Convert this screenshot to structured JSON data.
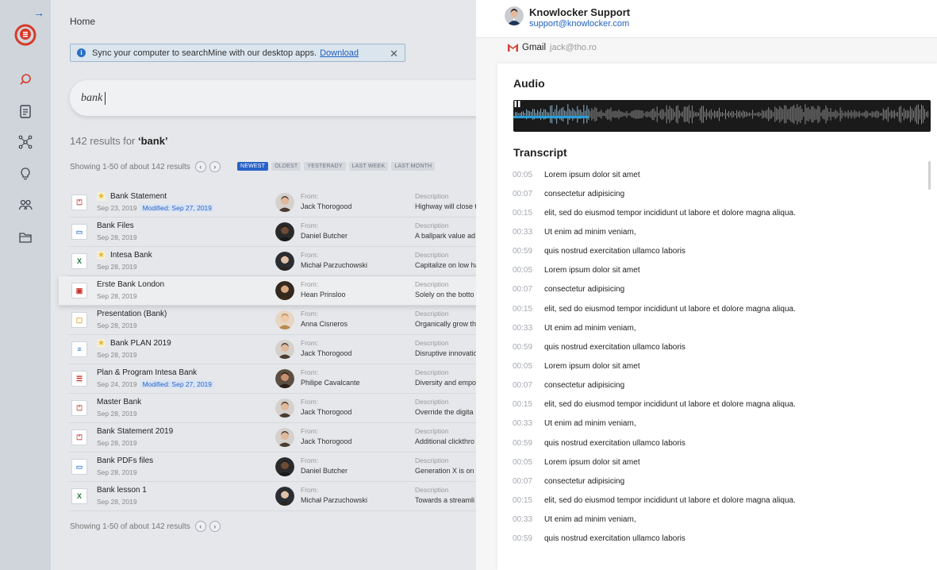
{
  "breadcrumb": "Home",
  "sync": {
    "text": "Sync your computer to searchMine with our desktop apps.",
    "link": "Download"
  },
  "search": {
    "query": "bank"
  },
  "results": {
    "count_prefix": "142 results for ",
    "count_query": "‘bank’",
    "showing": "Showing 1-50 of about 142 results",
    "filters": [
      "NEWEST",
      "OLDEST",
      "YESTERADY",
      "LAST WEEK",
      "LAST MONTH"
    ],
    "from_label": "From:",
    "desc_label": "Description",
    "rows": [
      {
        "name": "Bank Statement",
        "date": "Sep 23, 2019",
        "modified": "Modified: Sep 27, 2019",
        "from": "Jack Thorogood",
        "desc": "Highway will close t",
        "type": "pdf",
        "starred": true
      },
      {
        "name": "Bank Files",
        "date": "Sep 28, 2019",
        "modified": "",
        "from": "Daniel Butcher",
        "desc": "A ballpark value ad",
        "type": "folder",
        "starred": false
      },
      {
        "name": "Intesa Bank",
        "date": "Sep 28, 2019",
        "modified": "",
        "from": "Michał Parzuchowski",
        "desc": "Capitalize on low ha",
        "type": "excel",
        "starred": true
      },
      {
        "name": "Erste Bank London",
        "date": "Sep 28, 2019",
        "modified": "",
        "from": "Hean Prinsloo",
        "desc": "Solely on the botto",
        "type": "image",
        "starred": false
      },
      {
        "name": "Presentation (Bank)",
        "date": "Sep 28, 2019",
        "modified": "",
        "from": "Anna Cisneros",
        "desc": "Organically grow th",
        "type": "slides",
        "starred": false
      },
      {
        "name": "Bank PLAN 2019",
        "date": "Sep 28, 2019",
        "modified": "",
        "from": "Jack Thorogood",
        "desc": "Disruptive innovatio",
        "type": "doc",
        "starred": true
      },
      {
        "name": "Plan & Program Intesa Bank",
        "date": "Sep 24, 2019",
        "modified": "Modified: Sep 27, 2019",
        "from": "Philipe Cavalcante",
        "desc": "Diversity and empo",
        "type": "text",
        "starred": false
      },
      {
        "name": "Master Bank",
        "date": "Sep 28, 2019",
        "modified": "",
        "from": "Jack Thorogood",
        "desc": "Override the digita",
        "type": "pdf",
        "starred": false
      },
      {
        "name": "Bank Statement 2019",
        "date": "Sep 28, 2019",
        "modified": "",
        "from": "Jack Thorogood",
        "desc": "Additional clickthro",
        "type": "pdf",
        "starred": false
      },
      {
        "name": "Bank PDFs files",
        "date": "Sep 28, 2019",
        "modified": "",
        "from": "Daniel Butcher",
        "desc": "Generation X is on t",
        "type": "folder",
        "starred": false
      },
      {
        "name": "Bank lesson 1",
        "date": "Sep 28, 2019",
        "modified": "",
        "from": "Michał Parzuchowski",
        "desc": "Towards a streamli",
        "type": "excel",
        "starred": false
      }
    ]
  },
  "panel": {
    "support_name": "Knowlocker Support",
    "support_email": "support@knowlocker.com",
    "source": "Gmail",
    "source_address": "jack@tho.ro",
    "audio_title": "Audio",
    "audio_progress": 0.18,
    "transcript_title": "Transcript",
    "transcript": [
      {
        "time": "00:05",
        "text": "Lorem ipsum dolor sit amet"
      },
      {
        "time": "00:07",
        "text": "consectetur adipisicing"
      },
      {
        "time": "00:15",
        "text": "elit, sed do eiusmod tempor incididunt ut labore et dolore magna aliqua."
      },
      {
        "time": "00:33",
        "text": "Ut enim ad minim veniam,"
      },
      {
        "time": "00:59",
        "text": "quis nostrud exercitation ullamco laboris"
      },
      {
        "time": "00:05",
        "text": "Lorem ipsum dolor sit amet"
      },
      {
        "time": "00:07",
        "text": "consectetur adipisicing"
      },
      {
        "time": "00:15",
        "text": "elit, sed do eiusmod tempor incididunt ut labore et dolore magna aliqua."
      },
      {
        "time": "00:33",
        "text": "Ut enim ad minim veniam,"
      },
      {
        "time": "00:59",
        "text": "quis nostrud exercitation ullamco laboris"
      },
      {
        "time": "00:05",
        "text": "Lorem ipsum dolor sit amet"
      },
      {
        "time": "00:07",
        "text": "consectetur adipisicing"
      },
      {
        "time": "00:15",
        "text": "elit, sed do eiusmod tempor incididunt ut labore et dolore magna aliqua."
      },
      {
        "time": "00:33",
        "text": "Ut enim ad minim veniam,"
      },
      {
        "time": "00:59",
        "text": "quis nostrud exercitation ullamco laboris"
      },
      {
        "time": "00:05",
        "text": "Lorem ipsum dolor sit amet"
      },
      {
        "time": "00:07",
        "text": "consectetur adipisicing"
      },
      {
        "time": "00:15",
        "text": "elit, sed do eiusmod tempor incididunt ut labore et dolore magna aliqua."
      },
      {
        "time": "00:33",
        "text": "Ut enim ad minim veniam,"
      },
      {
        "time": "00:59",
        "text": "quis nostrud exercitation ullamco laboris"
      }
    ]
  },
  "colors": {
    "accent": "#2962c8",
    "brand": "#d73a2a",
    "audio_progress": "#2a9fd8"
  },
  "icons": [
    "arrow-right-icon",
    "logo-icon",
    "search-icon",
    "clipboard-icon",
    "network-icon",
    "lightbulb-icon",
    "people-icon",
    "folder-icon",
    "info-icon",
    "close-icon",
    "star-icon",
    "pause-icon",
    "gmail-icon"
  ]
}
